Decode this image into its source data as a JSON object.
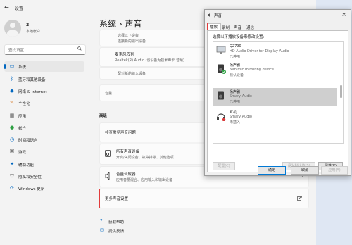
{
  "window": {
    "title": "设置"
  },
  "profile": {
    "name": "2",
    "subtitle": "本地帐户"
  },
  "search": {
    "placeholder": "查找设置"
  },
  "sidebar": {
    "items": [
      {
        "label": "系统",
        "icon": "monitor-icon",
        "active": true
      },
      {
        "label": "蓝牙和其他设备",
        "icon": "bluetooth-icon"
      },
      {
        "label": "网络 & Internet",
        "icon": "network-icon"
      },
      {
        "label": "个性化",
        "icon": "brush-icon"
      },
      {
        "label": "应用",
        "icon": "apps-icon"
      },
      {
        "label": "帐户",
        "icon": "account-icon"
      },
      {
        "label": "时间和语言",
        "icon": "clock-globe-icon"
      },
      {
        "label": "游戏",
        "icon": "gamepad-icon"
      },
      {
        "label": "辅助功能",
        "icon": "accessibility-icon"
      },
      {
        "label": "隐私和安全性",
        "icon": "shield-icon"
      },
      {
        "label": "Windows 更新",
        "icon": "update-icon"
      }
    ]
  },
  "breadcrumb": {
    "parent": "系统",
    "separator": "›",
    "current": "声音"
  },
  "main": {
    "faded_text_1": "选择以下设备",
    "faded_text_2": "连接新的输出设备",
    "mic_title": "麦克风阵列",
    "mic_sub": "Realtek(R) Audio (该设备为技术声卡 音频)",
    "pair_label": "配对新的输入设备",
    "volume_label": "音量",
    "advanced_header": "高级",
    "troubleshoot_label": "排查常见声音问题",
    "all_devices_title": "所有声音设备",
    "all_devices_sub": "开启/关闭设备、故障排除、其他选项",
    "mixer_title": "音量合成器",
    "mixer_sub": "应用音量混合、应用输入和输出设备",
    "more_settings_label": "更多声音设置",
    "help_label": "获取帮助",
    "feedback_label": "提供反馈"
  },
  "dialog": {
    "title": "声音",
    "tabs": [
      "播放",
      "录制",
      "声音",
      "通信"
    ],
    "instruction": "选择以下播放设备来修改设置:",
    "devices": [
      {
        "name": "Q2790",
        "desc": "HD Audio Driver for Display Audio",
        "status": "已停用",
        "icon": "monitor-speaker-icon"
      },
      {
        "name": "扬声器",
        "desc": "Nahimic mirroring device",
        "status": "默认设备",
        "icon": "speaker-icon",
        "badge": "green-check"
      },
      {
        "name": "扬声器",
        "desc": "Smary Audio",
        "status": "已停用",
        "icon": "speaker-icon",
        "selected": true
      },
      {
        "name": "耳机",
        "desc": "Smary Audio",
        "status": "未插入",
        "icon": "headphones-icon",
        "badge": "red-down"
      }
    ],
    "buttons": {
      "configure": "配置(C)",
      "set_default": "设为默认值(S)",
      "properties": "属性(P)",
      "ok": "确定",
      "cancel": "取消",
      "apply": "应用(A)"
    }
  },
  "colors": {
    "accent": "#0067c0",
    "highlight": "#e23b3b"
  }
}
